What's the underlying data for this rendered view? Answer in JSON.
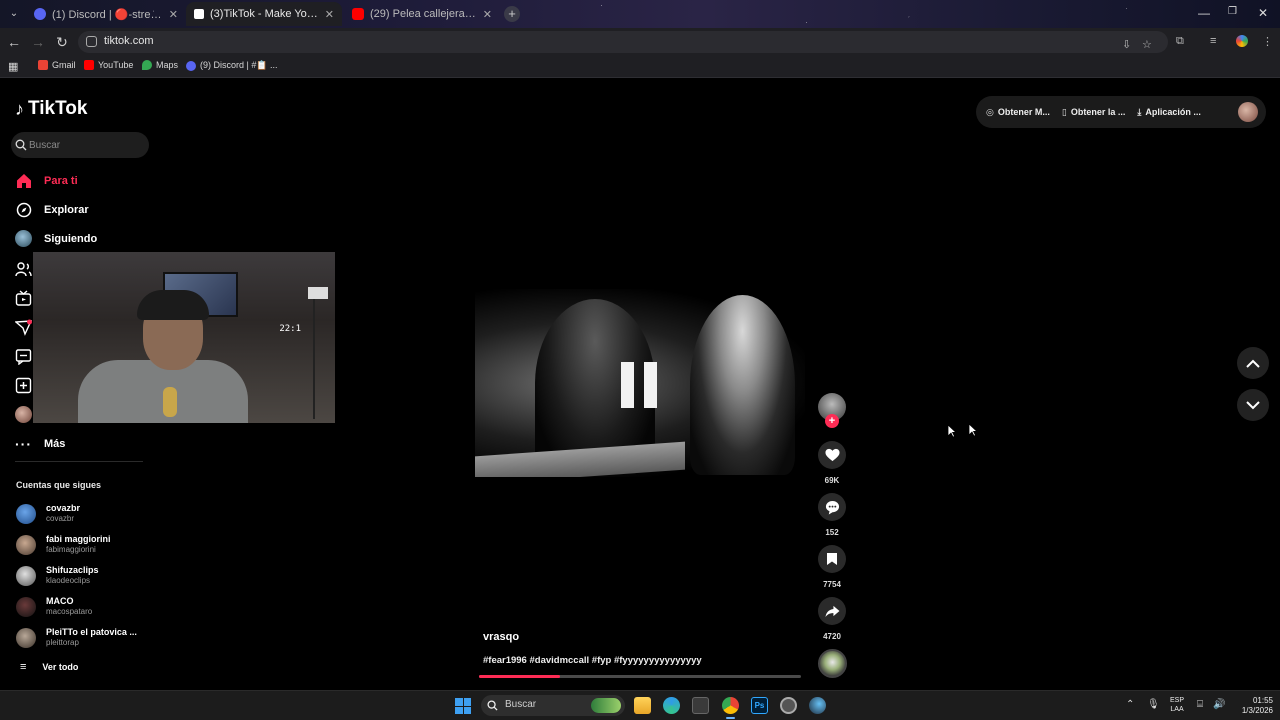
{
  "browser": {
    "tabs": [
      {
        "title": "(1) Discord | 🔴-stream-live",
        "active": false,
        "favicon_color": "#5865f2"
      },
      {
        "title": "(3)TikTok - Make Your Day",
        "active": true,
        "favicon_color": "#ffffff"
      },
      {
        "title": "(29) Pelea callejera - YouTube",
        "active": false,
        "favicon_color": "#ff0000"
      }
    ],
    "new_tab_label": "+",
    "url": "tiktok.com",
    "bookmarks": [
      {
        "label": "Gmail",
        "color": "#ea4335"
      },
      {
        "label": "YouTube",
        "color": "#ff0000"
      },
      {
        "label": "Maps",
        "color": "#34a853"
      },
      {
        "label": "(9) Discord | #📋 ...",
        "color": "#5865f2"
      }
    ]
  },
  "tiktok": {
    "logo_text": "TikTok",
    "search_placeholder": "Buscar",
    "nav": [
      {
        "label": "Para ti",
        "icon": "home-icon",
        "active": true
      },
      {
        "label": "Explorar",
        "icon": "compass-icon",
        "active": false
      },
      {
        "label": "Siguiendo",
        "icon": "following-avatar-icon",
        "active": false
      }
    ],
    "more_label": "Más",
    "following_title": "Cuentas que sigues",
    "accounts": [
      {
        "name": "covazbr",
        "handle": "covazbr",
        "color": "#3a78c9"
      },
      {
        "name": "fabi maggiorini",
        "handle": "fabimaggiorini",
        "color": "#7a6a5a"
      },
      {
        "name": "Shifuzaclips",
        "handle": "klaodeoclips",
        "color": "#9a9a9a"
      },
      {
        "name": "MACO",
        "handle": "macospataro",
        "color": "#3a2a2a"
      },
      {
        "name": "PleiTTo el patovica ...",
        "handle": "pleittorap",
        "color": "#8a7a6a"
      }
    ],
    "see_all_label": "Ver todo",
    "top_actions": [
      {
        "label": "Obtener M...",
        "icon": "coin-icon"
      },
      {
        "label": "Obtener la ...",
        "icon": "phone-icon"
      },
      {
        "label": "Aplicación ...",
        "icon": "download-icon"
      }
    ],
    "video": {
      "author": "vrasqo",
      "caption": "#fear1996 #davidmccall #fyp #fyyyyyyyyyyyyyyy",
      "progress_percent": 25,
      "likes": "69K",
      "comments": "152",
      "saves": "7754",
      "shares": "4720"
    },
    "webcam": {
      "clock_text": "22:1"
    }
  },
  "taskbar": {
    "search_placeholder": "Buscar",
    "language_line1": "ESP",
    "language_line2": "LAA",
    "time": "01:55",
    "date": "1/3/2026"
  },
  "colors": {
    "accent": "#fe2c55",
    "background": "#000000"
  }
}
